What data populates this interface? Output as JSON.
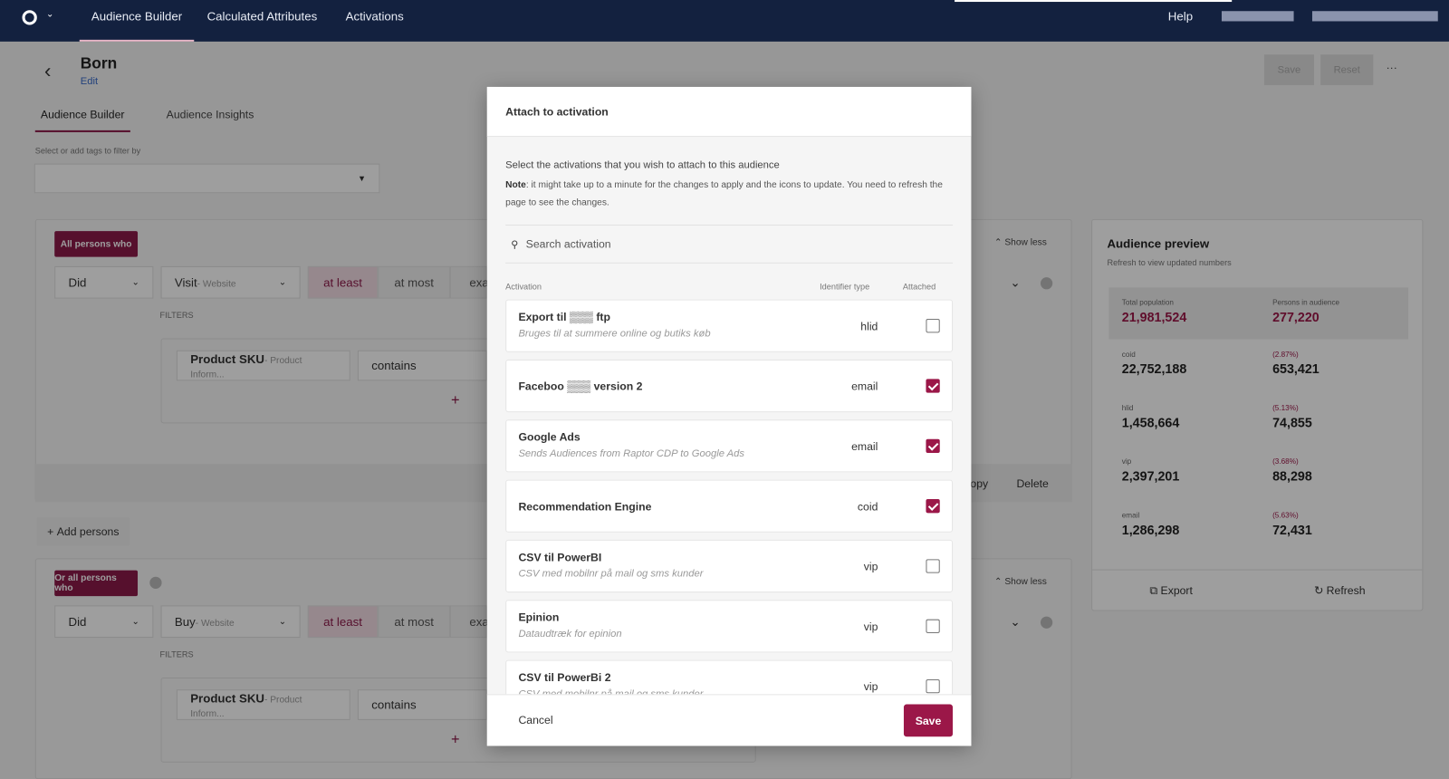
{
  "topbar": {
    "nav": [
      "Audience Builder",
      "Calculated Attributes",
      "Activations"
    ],
    "help": "Help"
  },
  "page": {
    "title": "Born",
    "edit": "Edit",
    "save": "Save",
    "reset": "Reset",
    "more": "···",
    "tabs": [
      "Audience Builder",
      "Audience Insights"
    ],
    "tag_label": "Select or add tags to filter by",
    "groups": [
      {
        "chip": "All persons who",
        "did": "Did",
        "event": "Visit",
        "event_source": "- Website",
        "at_least": "at least",
        "at_most": "at most",
        "exactly": "exa",
        "filters": "FILTERS",
        "filter_field": "Product SKU",
        "filter_source": "- Product Inform...",
        "operator": "contains",
        "show_less": "Show less"
      },
      {
        "chip": "Or all persons who",
        "did": "Did",
        "event": "Buy",
        "event_source": "- Website",
        "at_least": "at least",
        "at_most": "at most",
        "exactly": "exa",
        "filters": "FILTERS",
        "filter_field": "Product SKU",
        "filter_source": "- Product Inform...",
        "operator": "contains",
        "show_less": "Show less"
      }
    ],
    "copy": "opy",
    "delete": "Delete",
    "add_persons": "Add persons"
  },
  "preview": {
    "title": "Audience preview",
    "subtitle": "Refresh to view updated numbers",
    "total_label": "Total population",
    "total": "21,981,524",
    "persons_label": "Persons in audience",
    "persons": "277,220",
    "rows": [
      {
        "id": "coid",
        "count": "22,752,188",
        "pct": "(2.87%)",
        "aud": "653,421"
      },
      {
        "id": "hlid",
        "count": "1,458,664",
        "pct": "(5.13%)",
        "aud": "74,855"
      },
      {
        "id": "vip",
        "count": "2,397,201",
        "pct": "(3.68%)",
        "aud": "88,298"
      },
      {
        "id": "email",
        "count": "1,286,298",
        "pct": "(5.63%)",
        "aud": "72,431"
      }
    ],
    "export": "Export",
    "refresh": "Refresh"
  },
  "modal": {
    "title": "Attach to activation",
    "intro": "Select the activations that you wish to attach to this audience",
    "note_bold": "Note",
    "note": ": it might take up to a minute for the changes to apply and the icons to update. You need to refresh the page to see the changes.",
    "search_placeholder": "Search activation",
    "col_activation": "Activation",
    "col_identifier": "Identifier type",
    "col_attached": "Attached",
    "rows": [
      {
        "name": "Export til ▒▒▒ ftp",
        "desc": "Bruges til at summere online og butiks køb",
        "id": "hlid",
        "attached": false
      },
      {
        "name": "Faceboo ▒▒▒ version 2",
        "desc": "",
        "id": "email",
        "attached": true
      },
      {
        "name": "Google Ads",
        "desc": "Sends Audiences from Raptor CDP to Google Ads",
        "id": "email",
        "attached": true
      },
      {
        "name": "Recommendation Engine",
        "desc": "",
        "id": "coid",
        "attached": true
      },
      {
        "name": "CSV til PowerBI",
        "desc": "CSV med mobilnr på mail og sms kunder",
        "id": "vip",
        "attached": false
      },
      {
        "name": "Epinion",
        "desc": "Dataudtræk for epinion",
        "id": "vip",
        "attached": false
      },
      {
        "name": "CSV til PowerBi 2",
        "desc": "CSV med mobilnr på mail og sms kunder",
        "id": "vip",
        "attached": false
      }
    ],
    "cancel": "Cancel",
    "save": "Save"
  },
  "colors": {
    "brand": "#8c1a4a",
    "topbar": "#13213f"
  }
}
